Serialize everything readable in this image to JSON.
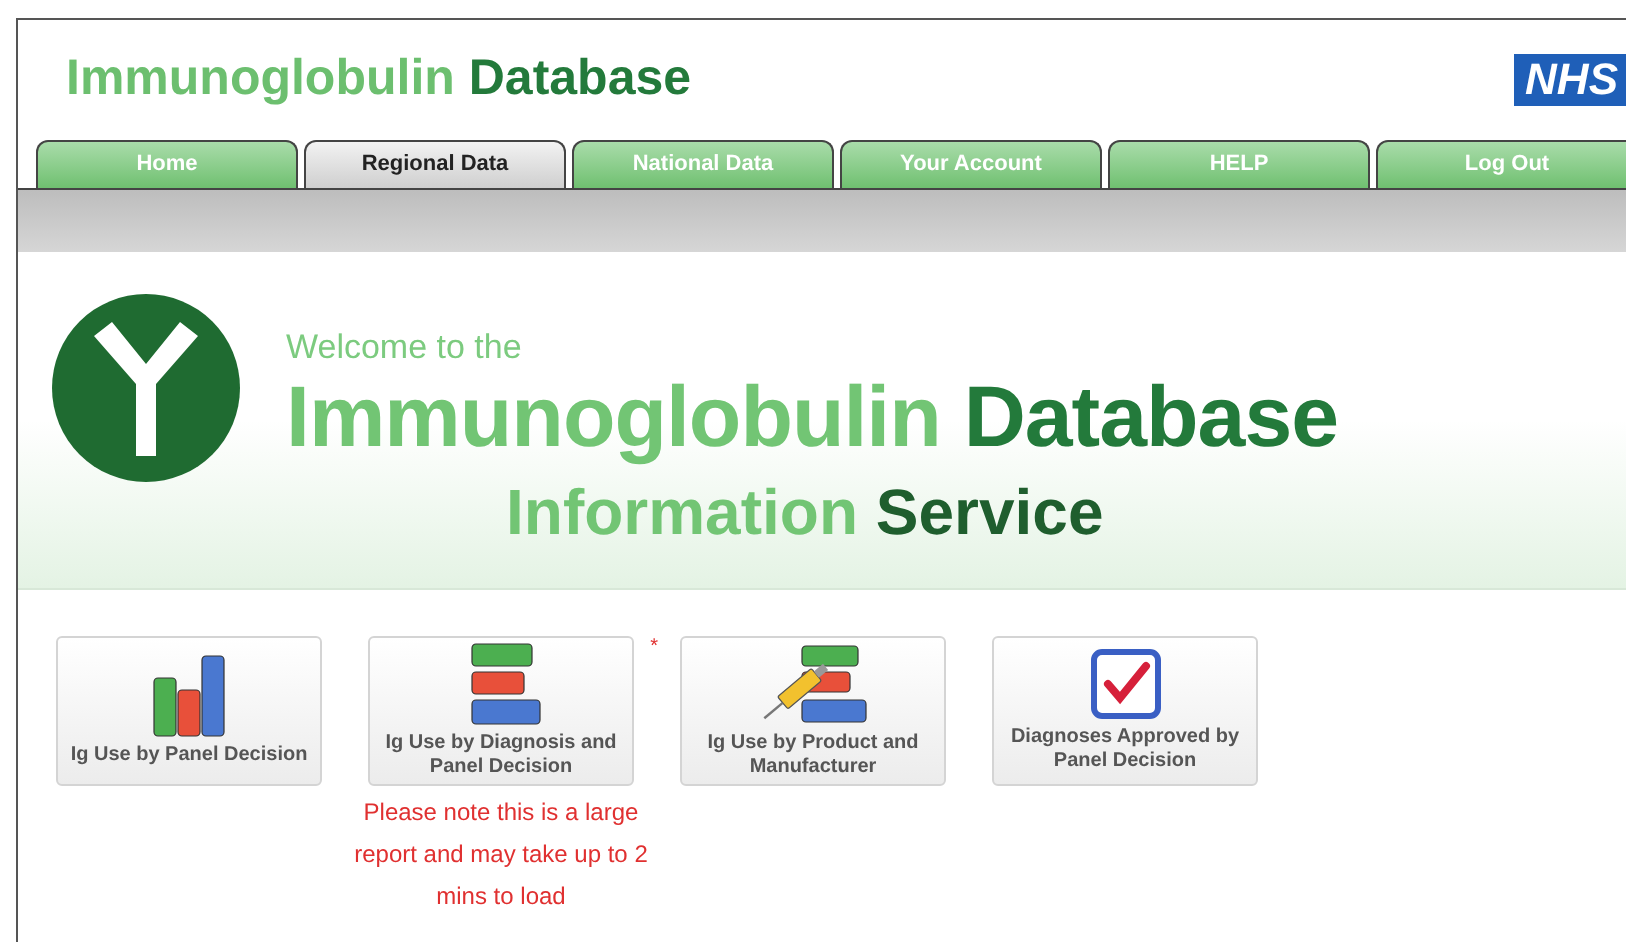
{
  "header": {
    "title_light": "Immunoglobulin",
    "title_dark": "Database",
    "logo": "NHS"
  },
  "tabs": [
    {
      "label": "Home",
      "selected": false
    },
    {
      "label": "Regional Data",
      "selected": true
    },
    {
      "label": "National Data",
      "selected": false
    },
    {
      "label": "Your Account",
      "selected": false
    },
    {
      "label": "HELP",
      "selected": false
    },
    {
      "label": "Log Out",
      "selected": false
    }
  ],
  "banner": {
    "welcome": "Welcome to the",
    "title_light": "Immunoglobulin",
    "title_dark": "Database",
    "subtitle_light": "Information",
    "subtitle_dark": "Service"
  },
  "reports": [
    {
      "label": "Ig Use by Panel Decision",
      "kind": "bars"
    },
    {
      "label": "Ig Use by Diagnosis and Panel Decision",
      "kind": "hbars",
      "marker": "*",
      "note": "Please note this is a large report and may take up to 2 mins to load"
    },
    {
      "label": "Ig Use by Product and Manufacturer",
      "kind": "syringe"
    },
    {
      "label": "Diagnoses Approved by Panel Decision",
      "kind": "check"
    }
  ]
}
